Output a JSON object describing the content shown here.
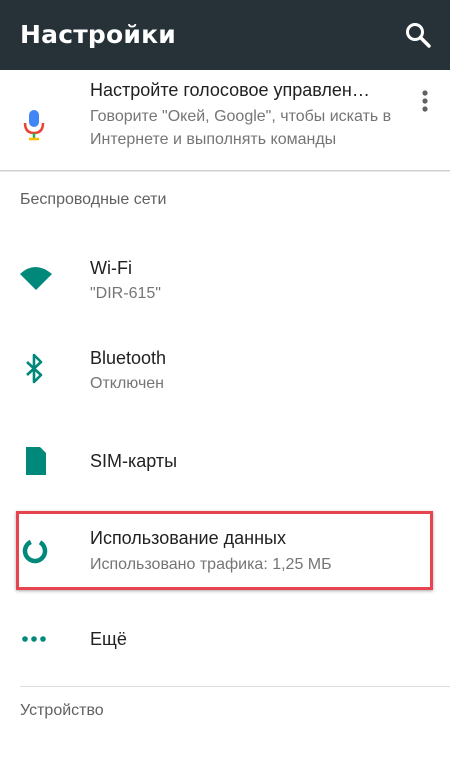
{
  "appbar": {
    "title": "Настройки",
    "search_icon": "search-icon"
  },
  "suggestion": {
    "title": "Настройте голосовое управлен…",
    "body": "Говорите \"Окей, Google\", чтобы искать в Интернете и выполнять команды",
    "icon": "microphone-icon",
    "menu_icon": "more-vertical-icon"
  },
  "sections": {
    "wireless": "Беспроводные сети",
    "device": "Устройство"
  },
  "items": {
    "wifi": {
      "title": "Wi-Fi",
      "subtitle": "\"DIR-615\"",
      "icon": "wifi-icon"
    },
    "bluetooth": {
      "title": "Bluetooth",
      "subtitle": "Отключен",
      "icon": "bluetooth-icon"
    },
    "sim": {
      "title": "SIM-карты",
      "icon": "sim-card-icon"
    },
    "data_usage": {
      "title": "Использование данных",
      "subtitle": "Использовано трафика: 1,25 МБ",
      "icon": "data-usage-icon"
    },
    "more": {
      "title": "Ещё",
      "icon": "more-horizontal-icon"
    }
  },
  "colors": {
    "appbar": "#263238",
    "accent": "#00897b",
    "highlight": "#e64550"
  }
}
